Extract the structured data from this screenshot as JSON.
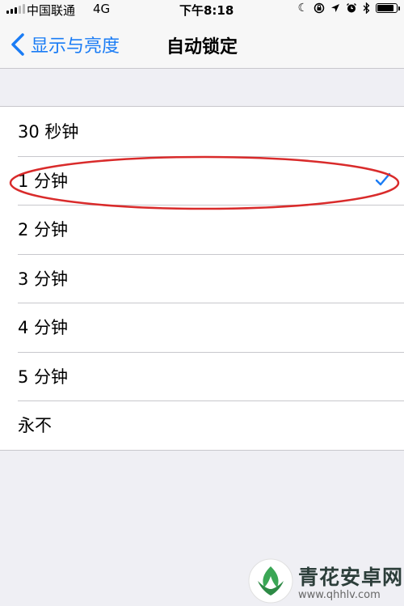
{
  "status_bar": {
    "carrier": "中国联通",
    "network": "4G",
    "time": "下午8:18",
    "icons": [
      "moon-icon",
      "rotation-lock-icon",
      "location-icon",
      "alarm-icon",
      "bluetooth-icon",
      "battery-icon"
    ]
  },
  "nav": {
    "back_label": "显示与亮度",
    "title": "自动锁定"
  },
  "options": [
    {
      "label": "30 秒钟",
      "selected": false
    },
    {
      "label": "1 分钟",
      "selected": true
    },
    {
      "label": "2 分钟",
      "selected": false
    },
    {
      "label": "3 分钟",
      "selected": false
    },
    {
      "label": "4 分钟",
      "selected": false
    },
    {
      "label": "5 分钟",
      "selected": false
    },
    {
      "label": "永不",
      "selected": false
    }
  ],
  "watermark": {
    "name": "青花安卓网",
    "url": "www.qhhlv.com"
  },
  "colors": {
    "accent": "#1a7cf5",
    "annotation": "#d92b2b",
    "background": "#efeff4"
  }
}
